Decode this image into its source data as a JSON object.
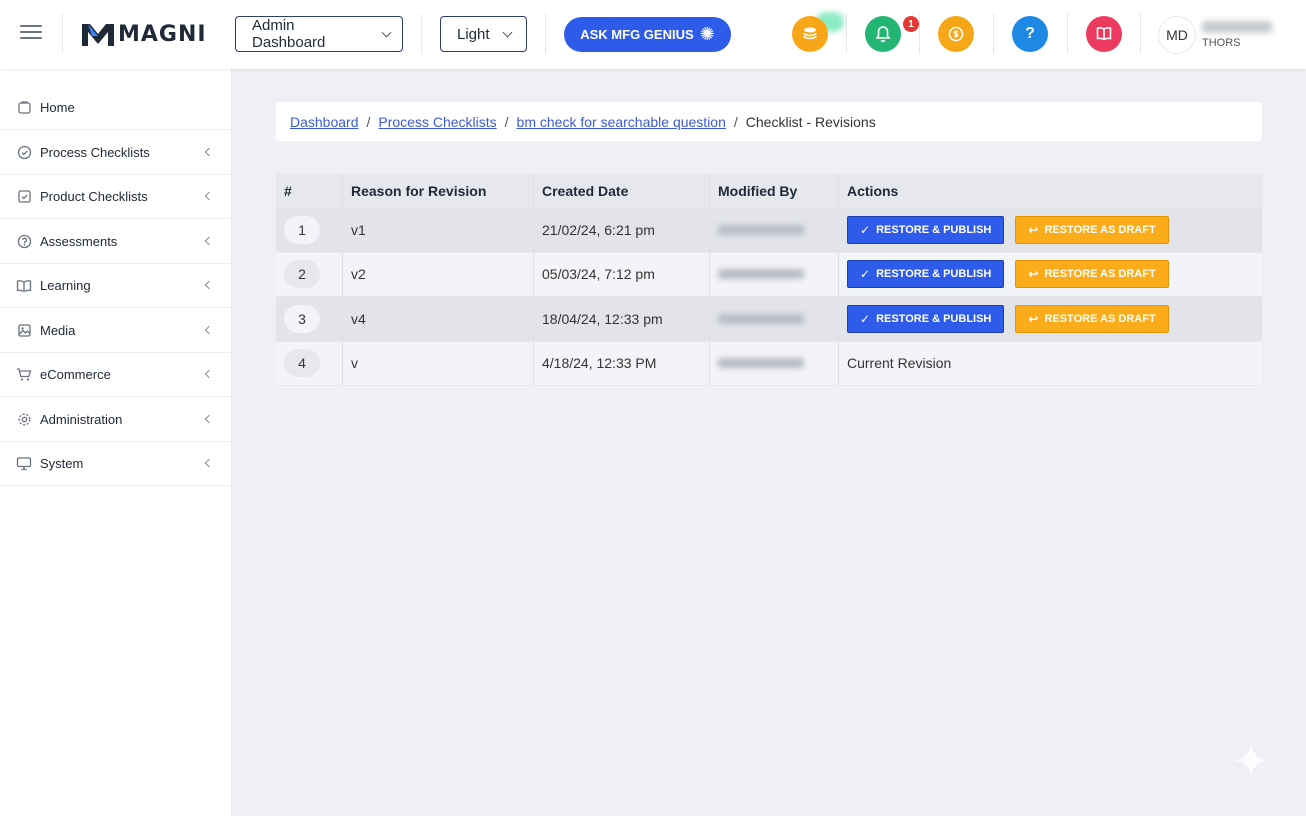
{
  "header": {
    "logo_text": "MAGNI",
    "dashboard_select": "Admin Dashboard",
    "theme_select": "Light",
    "genius_button": "ASK MFG GENIUS",
    "notification_count": "1",
    "help_icon_text": "?",
    "avatar_initials": "MD",
    "user_org": "THORS",
    "colors": {
      "coins": "#f6a617",
      "bell": "#22b573",
      "dollar": "#f6a617",
      "help": "#1e88e5",
      "book": "#ec3a5f",
      "genius": "#2f5bea"
    }
  },
  "sidebar": {
    "items": [
      {
        "label": "Home",
        "icon": "home-icon",
        "has_arrow": false
      },
      {
        "label": "Process Checklists",
        "icon": "check-circle-icon",
        "has_arrow": true
      },
      {
        "label": "Product Checklists",
        "icon": "check-square-icon",
        "has_arrow": true
      },
      {
        "label": "Assessments",
        "icon": "question-circle-icon",
        "has_arrow": true
      },
      {
        "label": "Learning",
        "icon": "book-open-icon",
        "has_arrow": true
      },
      {
        "label": "Media",
        "icon": "image-icon",
        "has_arrow": true
      },
      {
        "label": "eCommerce",
        "icon": "cart-icon",
        "has_arrow": true
      },
      {
        "label": "Administration",
        "icon": "gear-icon",
        "has_arrow": true
      },
      {
        "label": "System",
        "icon": "monitor-icon",
        "has_arrow": true
      }
    ]
  },
  "breadcrumb": {
    "items": [
      "Dashboard",
      "Process Checklists",
      "bm check for searchable question"
    ],
    "current": "Checklist - Revisions"
  },
  "table": {
    "headers": [
      "#",
      "Reason for Revision",
      "Created Date",
      "Modified By",
      "Actions"
    ],
    "rows": [
      {
        "num": "1",
        "reason": "v1",
        "created": "21/02/24, 6:21 pm",
        "current_text": ""
      },
      {
        "num": "2",
        "reason": "v2",
        "created": "05/03/24, 7:12 pm",
        "current_text": ""
      },
      {
        "num": "3",
        "reason": "v4",
        "created": "18/04/24, 12:33 pm",
        "current_text": ""
      },
      {
        "num": "4",
        "reason": "v",
        "created": "4/18/24, 12:33 PM",
        "current_text": "Current Revision"
      }
    ],
    "restore_publish_label": "RESTORE & PUBLISH",
    "restore_draft_label": "RESTORE AS DRAFT"
  }
}
